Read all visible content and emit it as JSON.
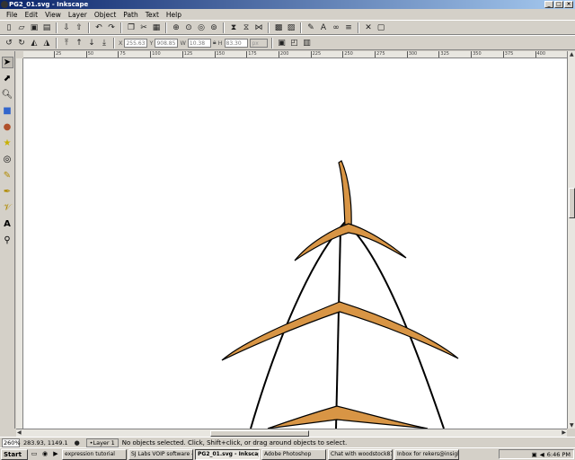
{
  "window": {
    "title": "PG2_01.svg - Inkscape",
    "buttons": [
      "_",
      "□",
      "×"
    ]
  },
  "menu": [
    "File",
    "Edit",
    "View",
    "Layer",
    "Object",
    "Path",
    "Text",
    "Help"
  ],
  "main_toolbar_icons": [
    "new-icon",
    "open-icon",
    "save-icon",
    "print-icon",
    "import-icon",
    "export-icon",
    "undo-icon",
    "redo-icon",
    "copy-icon",
    "cut-icon",
    "paste-icon",
    "zoom-selection-icon",
    "zoom-drawing-icon",
    "zoom-page-icon",
    "duplicate-icon",
    "clone-icon",
    "unlink-icon",
    "group-icon",
    "ungroup-icon",
    "fill-stroke-icon",
    "text-font-icon",
    "xml-editor-icon",
    "align-icon",
    "preferences-icon"
  ],
  "controls": {
    "x_label": "X",
    "x_value": "255.63",
    "y_label": "Y",
    "y_value": "908.85",
    "w_label": "W",
    "w_value": "10.38",
    "h_label": "H",
    "h_value": "83.30",
    "unit": "px"
  },
  "tools": [
    "selector-tool",
    "node-tool",
    "zoom-tool",
    "rectangle-tool",
    "ellipse-tool",
    "star-tool",
    "spiral-tool",
    "pencil-tool",
    "pen-tool",
    "calligraphy-tool",
    "text-tool",
    "dropper-tool"
  ],
  "ruler_top_ticks": [
    "25",
    "50",
    "75",
    "100",
    "125",
    "150",
    "175",
    "200",
    "225",
    "250",
    "275",
    "300",
    "325",
    "350",
    "375",
    "400",
    "425"
  ],
  "colors": {
    "accent": "#d89545",
    "stroke": "#000000",
    "titlebar": "#0a246a"
  },
  "status": {
    "zoom": "260%",
    "coords": "283.93, 1149.1",
    "layer": "•Layer 1",
    "message": "No objects selected. Click, Shift+click, or drag around objects to select."
  },
  "taskbar": {
    "start": "Start",
    "tasks": [
      "expression tutorial",
      "SJ Labs VOIP software - ...",
      "PG2_01.svg - Inkscape",
      "Adobe Photoshop",
      "Chat with woodstock870...",
      "Inbox for rekers@insight..."
    ],
    "clock": "6:46 PM"
  }
}
